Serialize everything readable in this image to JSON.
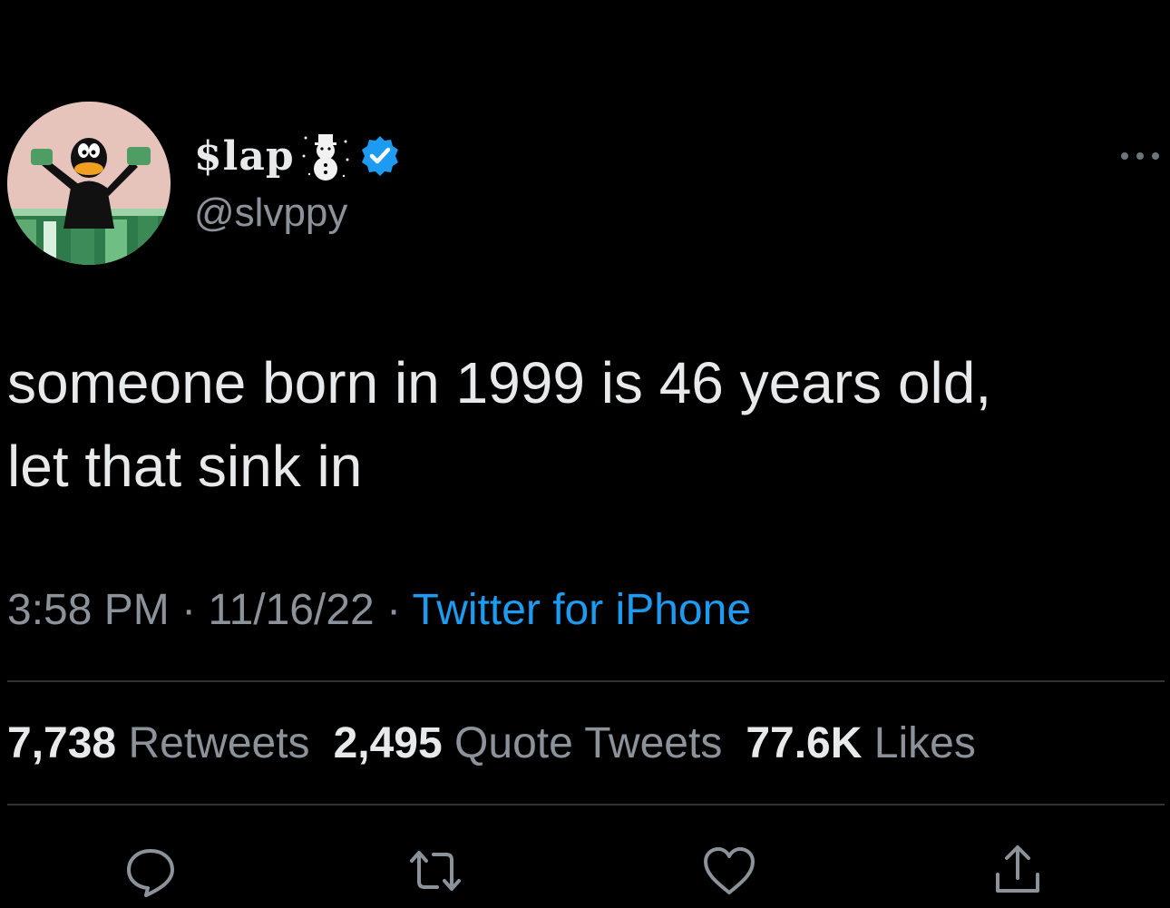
{
  "user": {
    "display_name": "$lap",
    "handle": "@slvppy",
    "verified": true,
    "avatar_icon": "daffy-duck-money-avatar",
    "name_emoji_icon": "snowman-icon",
    "verified_color": "#1d9bf0"
  },
  "tweet": {
    "text_line_1": "someone born in 1999 is 46 years old,",
    "text_line_2": "let that sink in",
    "time": "3:58 PM",
    "date": "11/16/22",
    "separator": "·",
    "source": "Twitter for iPhone"
  },
  "stats": {
    "retweets_count": "7,738",
    "retweets_label": "Retweets",
    "quote_tweets_count": "2,495",
    "quote_tweets_label": "Quote Tweets",
    "likes_count": "77.6K",
    "likes_label": "Likes"
  },
  "actions": {
    "icons": [
      "reply-icon",
      "retweet-icon",
      "like-icon",
      "share-icon"
    ]
  },
  "colors": {
    "background": "#000000",
    "text": "#e7e9ea",
    "secondary": "#8b9299",
    "accent": "#1d9bf0"
  }
}
